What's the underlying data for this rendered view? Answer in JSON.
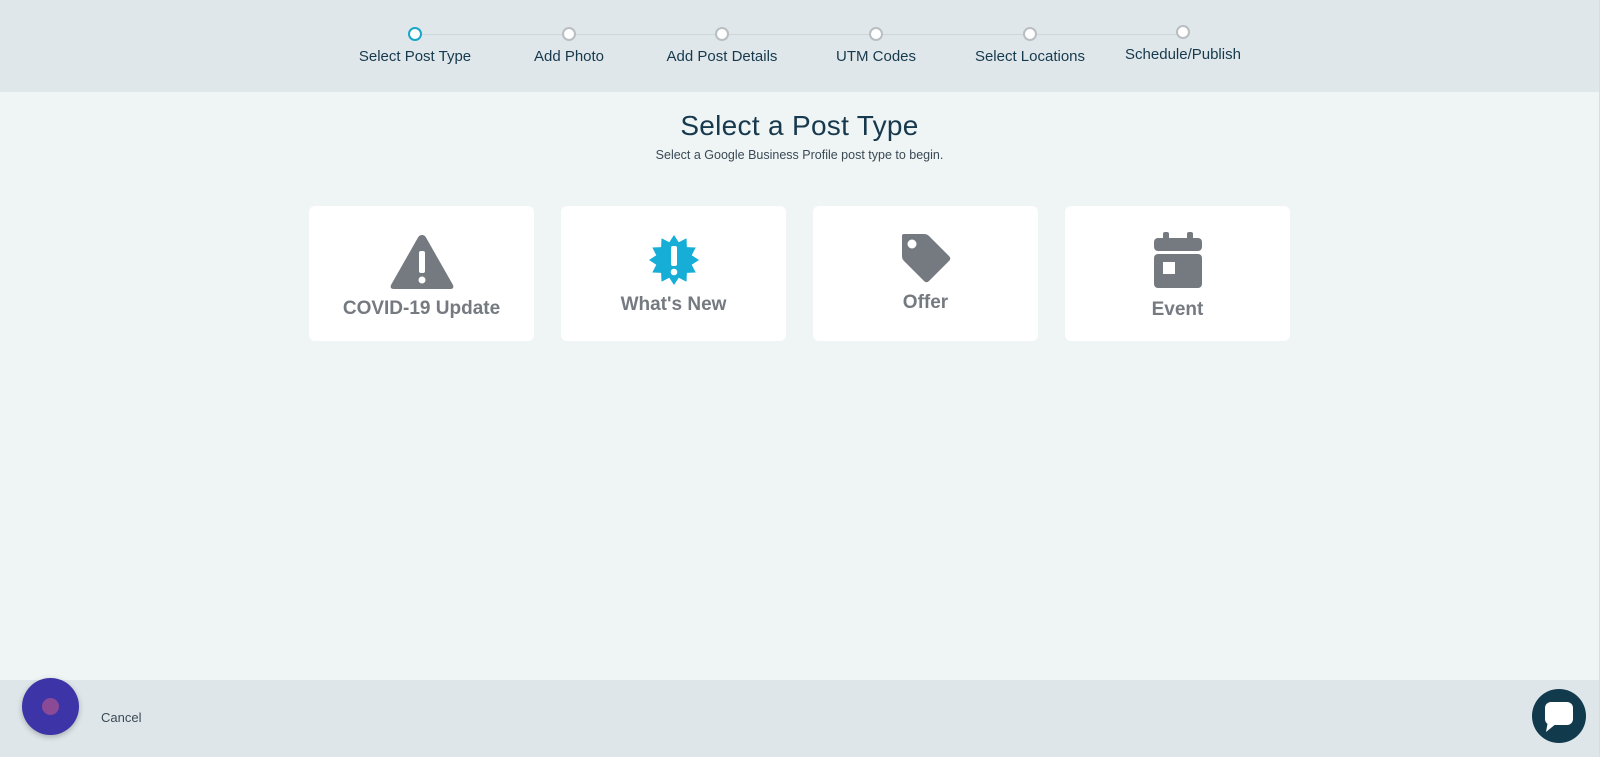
{
  "stepper": {
    "steps": [
      {
        "label": "Select Post Type",
        "active": true
      },
      {
        "label": "Add Photo",
        "active": false
      },
      {
        "label": "Add Post Details",
        "active": false
      },
      {
        "label": "UTM Codes",
        "active": false
      },
      {
        "label": "Select Locations",
        "active": false
      },
      {
        "label": "Schedule/Publish",
        "active": false
      }
    ]
  },
  "main": {
    "title": "Select a Post Type",
    "subtitle": "Select a Google Business Profile post type to begin.",
    "post_types": [
      {
        "label": "COVID-19 Update",
        "icon": "warning-icon"
      },
      {
        "label": "What's New",
        "icon": "new-badge-icon"
      },
      {
        "label": "Offer",
        "icon": "tag-icon"
      },
      {
        "label": "Event",
        "icon": "calendar-icon"
      }
    ]
  },
  "footer": {
    "cancel_label": "Cancel"
  },
  "colors": {
    "accent": "#1aa6c9",
    "header_bg": "#e0e7ea",
    "page_bg": "#eff4f5",
    "text_dark": "#16394d",
    "icon_gray": "#757a80",
    "help_button": "#3d34a8",
    "chat_button": "#113a4d"
  }
}
